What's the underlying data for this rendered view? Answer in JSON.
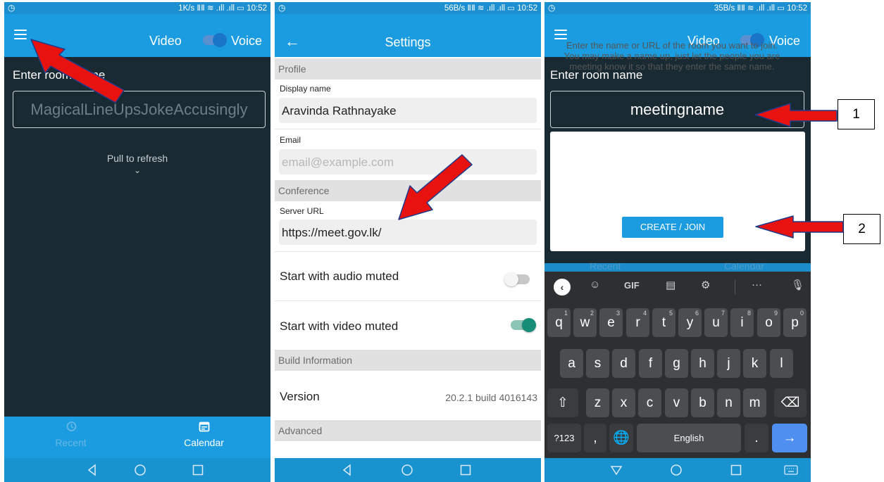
{
  "status_bars": [
    {
      "right_text": "1K/s ⅡⅡ ≋ .ıll .ıll ▭ 10:52"
    },
    {
      "right_text": "56B/s ⅡⅡ ≋ .ıll .ıll ▭ 10:52"
    },
    {
      "right_text": "35B/s ⅡⅡ ≋ .ıll .ıll ▭ 10:52"
    }
  ],
  "screen1": {
    "video_label": "Video",
    "voice_label": "Voice",
    "room_label": "Enter room name",
    "room_value": "MagicalLineUpsJokeAccusingly",
    "pull_to_refresh": "Pull to refresh",
    "tabs": {
      "recent": "Recent",
      "calendar": "Calendar"
    }
  },
  "screen2": {
    "title": "Settings",
    "sections": {
      "profile": "Profile",
      "conference": "Conference",
      "build": "Build Information",
      "advanced": "Advanced"
    },
    "display_name_label": "Display name",
    "display_name_value": "Aravinda Rathnayake",
    "email_label": "Email",
    "email_placeholder": "email@example.com",
    "server_url_label": "Server URL",
    "server_url_value": "https://meet.gov.lk/",
    "audio_muted_label": "Start with audio muted",
    "audio_muted": false,
    "video_muted_label": "Start with video muted",
    "video_muted": true,
    "version_label": "Version",
    "version_value": "20.2.1 build 4016143"
  },
  "screen3": {
    "video_label": "Video",
    "voice_label": "Voice",
    "room_label": "Enter room name",
    "room_value": "meetingname",
    "info_text": "Enter the name or URL of the room you want to join. You may make a name up, just let the people you are meeting know it so that they enter the same name.",
    "join_button": "CREATE / JOIN",
    "keyboard": {
      "gif": "GIF",
      "row1": [
        "q",
        "w",
        "e",
        "r",
        "t",
        "y",
        "u",
        "i",
        "o",
        "p"
      ],
      "row1_hints": [
        "1",
        "2",
        "3",
        "4",
        "5",
        "6",
        "7",
        "8",
        "9",
        "0"
      ],
      "row2": [
        "a",
        "s",
        "d",
        "f",
        "g",
        "h",
        "j",
        "k",
        "l"
      ],
      "row3": [
        "z",
        "x",
        "c",
        "v",
        "b",
        "n",
        "m"
      ],
      "symbols_key": "?123",
      "comma_key": ",",
      "space_label": "English",
      "period_key": ".",
      "enter_key": "→"
    }
  },
  "callouts": [
    "1",
    "2"
  ],
  "colors": {
    "appbar": "#1c9ce0",
    "dark_bg": "#1a2a32",
    "arrow": "#e8130f",
    "switch_on": "#168d76"
  }
}
